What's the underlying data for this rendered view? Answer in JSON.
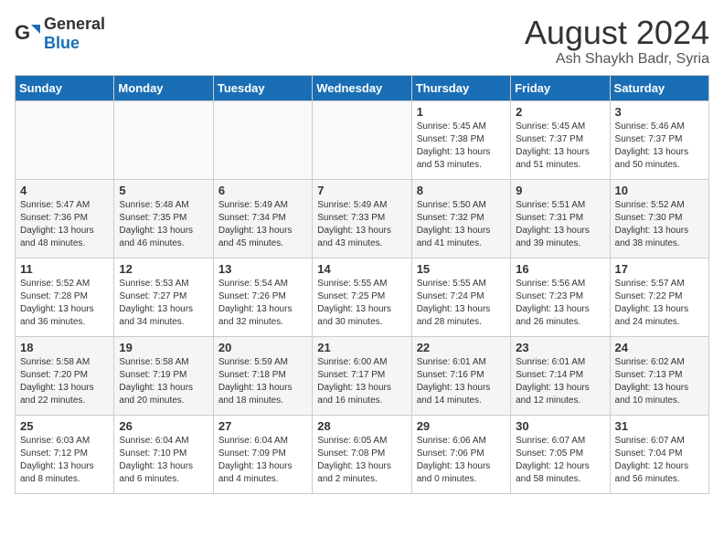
{
  "header": {
    "logo_general": "General",
    "logo_blue": "Blue",
    "title": "August 2024",
    "subtitle": "Ash Shaykh Badr, Syria"
  },
  "weekdays": [
    "Sunday",
    "Monday",
    "Tuesday",
    "Wednesday",
    "Thursday",
    "Friday",
    "Saturday"
  ],
  "weeks": [
    [
      {
        "day": "",
        "info": ""
      },
      {
        "day": "",
        "info": ""
      },
      {
        "day": "",
        "info": ""
      },
      {
        "day": "",
        "info": ""
      },
      {
        "day": "1",
        "info": "Sunrise: 5:45 AM\nSunset: 7:38 PM\nDaylight: 13 hours\nand 53 minutes."
      },
      {
        "day": "2",
        "info": "Sunrise: 5:45 AM\nSunset: 7:37 PM\nDaylight: 13 hours\nand 51 minutes."
      },
      {
        "day": "3",
        "info": "Sunrise: 5:46 AM\nSunset: 7:37 PM\nDaylight: 13 hours\nand 50 minutes."
      }
    ],
    [
      {
        "day": "4",
        "info": "Sunrise: 5:47 AM\nSunset: 7:36 PM\nDaylight: 13 hours\nand 48 minutes."
      },
      {
        "day": "5",
        "info": "Sunrise: 5:48 AM\nSunset: 7:35 PM\nDaylight: 13 hours\nand 46 minutes."
      },
      {
        "day": "6",
        "info": "Sunrise: 5:49 AM\nSunset: 7:34 PM\nDaylight: 13 hours\nand 45 minutes."
      },
      {
        "day": "7",
        "info": "Sunrise: 5:49 AM\nSunset: 7:33 PM\nDaylight: 13 hours\nand 43 minutes."
      },
      {
        "day": "8",
        "info": "Sunrise: 5:50 AM\nSunset: 7:32 PM\nDaylight: 13 hours\nand 41 minutes."
      },
      {
        "day": "9",
        "info": "Sunrise: 5:51 AM\nSunset: 7:31 PM\nDaylight: 13 hours\nand 39 minutes."
      },
      {
        "day": "10",
        "info": "Sunrise: 5:52 AM\nSunset: 7:30 PM\nDaylight: 13 hours\nand 38 minutes."
      }
    ],
    [
      {
        "day": "11",
        "info": "Sunrise: 5:52 AM\nSunset: 7:28 PM\nDaylight: 13 hours\nand 36 minutes."
      },
      {
        "day": "12",
        "info": "Sunrise: 5:53 AM\nSunset: 7:27 PM\nDaylight: 13 hours\nand 34 minutes."
      },
      {
        "day": "13",
        "info": "Sunrise: 5:54 AM\nSunset: 7:26 PM\nDaylight: 13 hours\nand 32 minutes."
      },
      {
        "day": "14",
        "info": "Sunrise: 5:55 AM\nSunset: 7:25 PM\nDaylight: 13 hours\nand 30 minutes."
      },
      {
        "day": "15",
        "info": "Sunrise: 5:55 AM\nSunset: 7:24 PM\nDaylight: 13 hours\nand 28 minutes."
      },
      {
        "day": "16",
        "info": "Sunrise: 5:56 AM\nSunset: 7:23 PM\nDaylight: 13 hours\nand 26 minutes."
      },
      {
        "day": "17",
        "info": "Sunrise: 5:57 AM\nSunset: 7:22 PM\nDaylight: 13 hours\nand 24 minutes."
      }
    ],
    [
      {
        "day": "18",
        "info": "Sunrise: 5:58 AM\nSunset: 7:20 PM\nDaylight: 13 hours\nand 22 minutes."
      },
      {
        "day": "19",
        "info": "Sunrise: 5:58 AM\nSunset: 7:19 PM\nDaylight: 13 hours\nand 20 minutes."
      },
      {
        "day": "20",
        "info": "Sunrise: 5:59 AM\nSunset: 7:18 PM\nDaylight: 13 hours\nand 18 minutes."
      },
      {
        "day": "21",
        "info": "Sunrise: 6:00 AM\nSunset: 7:17 PM\nDaylight: 13 hours\nand 16 minutes."
      },
      {
        "day": "22",
        "info": "Sunrise: 6:01 AM\nSunset: 7:16 PM\nDaylight: 13 hours\nand 14 minutes."
      },
      {
        "day": "23",
        "info": "Sunrise: 6:01 AM\nSunset: 7:14 PM\nDaylight: 13 hours\nand 12 minutes."
      },
      {
        "day": "24",
        "info": "Sunrise: 6:02 AM\nSunset: 7:13 PM\nDaylight: 13 hours\nand 10 minutes."
      }
    ],
    [
      {
        "day": "25",
        "info": "Sunrise: 6:03 AM\nSunset: 7:12 PM\nDaylight: 13 hours\nand 8 minutes."
      },
      {
        "day": "26",
        "info": "Sunrise: 6:04 AM\nSunset: 7:10 PM\nDaylight: 13 hours\nand 6 minutes."
      },
      {
        "day": "27",
        "info": "Sunrise: 6:04 AM\nSunset: 7:09 PM\nDaylight: 13 hours\nand 4 minutes."
      },
      {
        "day": "28",
        "info": "Sunrise: 6:05 AM\nSunset: 7:08 PM\nDaylight: 13 hours\nand 2 minutes."
      },
      {
        "day": "29",
        "info": "Sunrise: 6:06 AM\nSunset: 7:06 PM\nDaylight: 13 hours\nand 0 minutes."
      },
      {
        "day": "30",
        "info": "Sunrise: 6:07 AM\nSunset: 7:05 PM\nDaylight: 12 hours\nand 58 minutes."
      },
      {
        "day": "31",
        "info": "Sunrise: 6:07 AM\nSunset: 7:04 PM\nDaylight: 12 hours\nand 56 minutes."
      }
    ]
  ]
}
